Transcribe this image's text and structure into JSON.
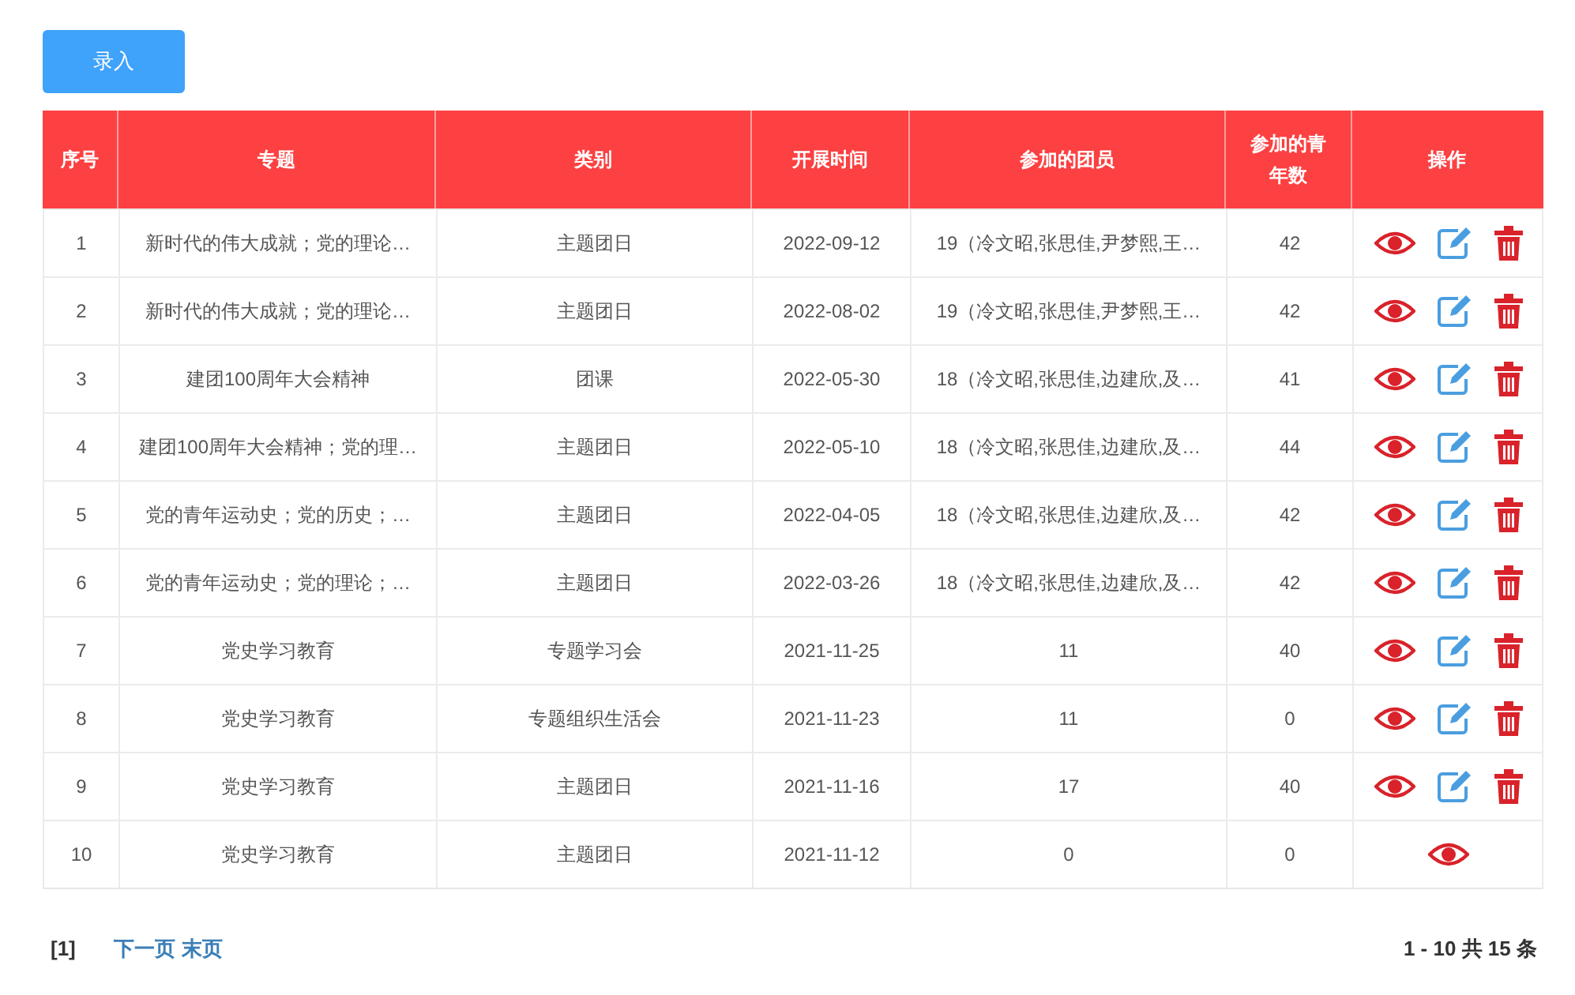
{
  "add_button": "录入",
  "table": {
    "columns": [
      "序号",
      "专题",
      "类别",
      "开展时间",
      "参加的团员",
      "参加的青年数",
      "操作"
    ],
    "rows": [
      {
        "cells": [
          "1",
          "新时代的伟大成就；党的理论…",
          "主题团日",
          "2022-09-12",
          "19（冷文昭,张思佳,尹梦熙,王…",
          "42"
        ],
        "editable": true
      },
      {
        "cells": [
          "2",
          "新时代的伟大成就；党的理论…",
          "主题团日",
          "2022-08-02",
          "19（冷文昭,张思佳,尹梦熙,王…",
          "42"
        ],
        "editable": true
      },
      {
        "cells": [
          "3",
          "建团100周年大会精神",
          "团课",
          "2022-05-30",
          "18（冷文昭,张思佳,边建欣,及…",
          "41"
        ],
        "editable": true
      },
      {
        "cells": [
          "4",
          "建团100周年大会精神；党的理…",
          "主题团日",
          "2022-05-10",
          "18（冷文昭,张思佳,边建欣,及…",
          "44"
        ],
        "editable": true
      },
      {
        "cells": [
          "5",
          "党的青年运动史；党的历史；…",
          "主题团日",
          "2022-04-05",
          "18（冷文昭,张思佳,边建欣,及…",
          "42"
        ],
        "editable": true
      },
      {
        "cells": [
          "6",
          "党的青年运动史；党的理论；…",
          "主题团日",
          "2022-03-26",
          "18（冷文昭,张思佳,边建欣,及…",
          "42"
        ],
        "editable": true
      },
      {
        "cells": [
          "7",
          "党史学习教育",
          "专题学习会",
          "2021-11-25",
          "11",
          "40"
        ],
        "editable": true
      },
      {
        "cells": [
          "8",
          "党史学习教育",
          "专题组织生活会",
          "2021-11-23",
          "11",
          "0"
        ],
        "editable": true
      },
      {
        "cells": [
          "9",
          "党史学习教育",
          "主题团日",
          "2021-11-16",
          "17",
          "40"
        ],
        "editable": true
      },
      {
        "cells": [
          "10",
          "党史学习教育",
          "主题团日",
          "2021-11-12",
          "0",
          "0"
        ],
        "editable": false
      }
    ]
  },
  "pagination": {
    "current": "[1]",
    "next": "下一页",
    "last": "末页",
    "summary": "1 - 10 共 15 条"
  }
}
